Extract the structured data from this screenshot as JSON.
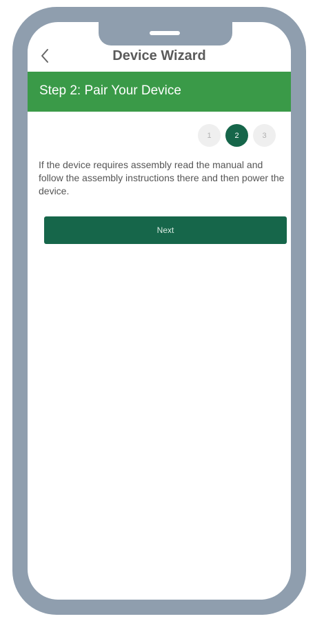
{
  "header": {
    "title": "Device Wizard",
    "back_icon": "chevron-left-icon"
  },
  "step": {
    "title": "Step 2: Pair Your Device"
  },
  "stepper": {
    "steps": [
      "1",
      "2",
      "3"
    ],
    "active": "2"
  },
  "content": {
    "instructions": "If the device requires assembly read the manual and follow the assembly instructions there and then power the device."
  },
  "actions": {
    "next_label": "Next"
  },
  "colors": {
    "banner": "#3a9a48",
    "primary": "#16664a",
    "phone_frame": "#8f9eae"
  }
}
